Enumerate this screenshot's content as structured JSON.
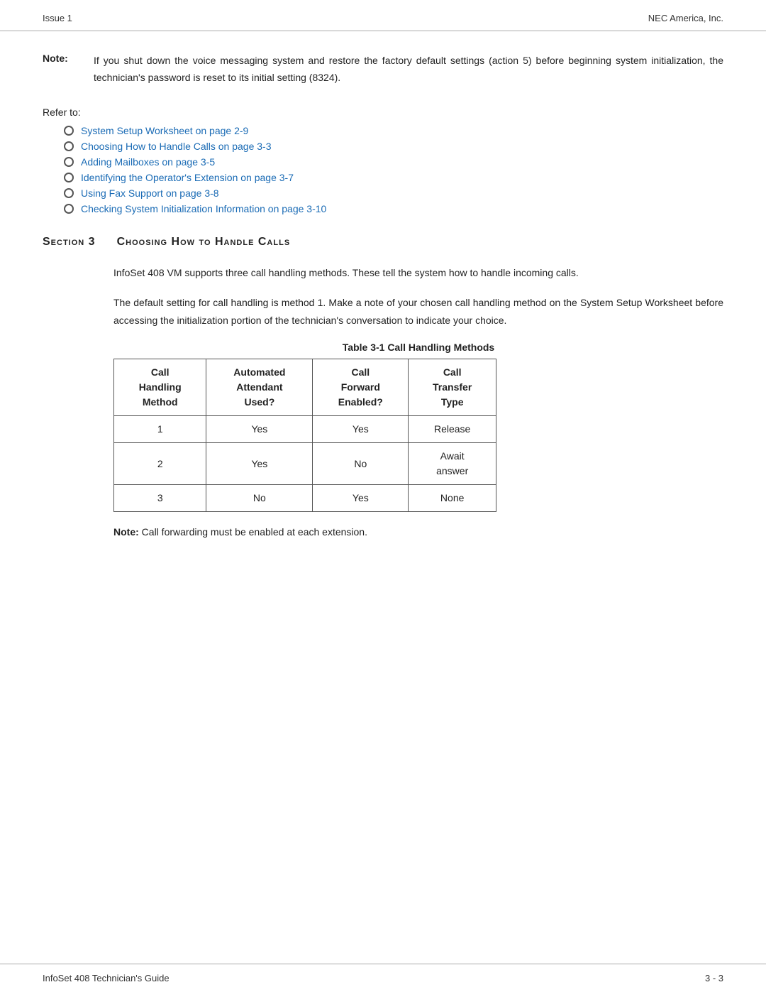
{
  "header": {
    "left": "Issue 1",
    "right": "NEC America, Inc."
  },
  "note": {
    "label": "Note:",
    "text": "If you shut down the voice messaging system and restore the factory default settings (action 5) before beginning system initialization, the technician's password is reset to its initial setting (8324)."
  },
  "refer_to": {
    "label": "Refer to:",
    "links": [
      "System Setup Worksheet on page 2-9",
      "Choosing How to Handle Calls on page 3-3",
      "Adding Mailboxes on page 3-5",
      "Identifying the Operator's Extension on page 3-7",
      "Using Fax Support on page 3-8",
      "Checking System Initialization Information on page 3-10"
    ]
  },
  "section": {
    "number": "Section 3",
    "title": "Choosing How to Handle Calls"
  },
  "paragraphs": [
    "InfoSet 408 VM supports three call handling methods. These tell the system how to handle incoming calls.",
    "The default setting for call handling is method 1. Make a note of your chosen call handling method on the System Setup Worksheet before accessing the initialization portion of the technician's conversation to indicate your choice."
  ],
  "table": {
    "caption": "Table 3-1  Call Handling Methods",
    "headers": [
      "Call\nHandling\nMethod",
      "Automated\nAttendant\nUsed?",
      "Call\nForward\nEnabled?",
      "Call\nTransfer\nType"
    ],
    "rows": [
      [
        "1",
        "Yes",
        "Yes",
        "Release"
      ],
      [
        "2",
        "Yes",
        "No",
        "Await\nanswer"
      ],
      [
        "3",
        "No",
        "Yes",
        "None"
      ]
    ]
  },
  "table_note": {
    "label": "Note:",
    "text": "Call forwarding must be enabled at each extension."
  },
  "footer": {
    "left": "InfoSet 408 Technician's Guide",
    "right": "3 - 3"
  }
}
